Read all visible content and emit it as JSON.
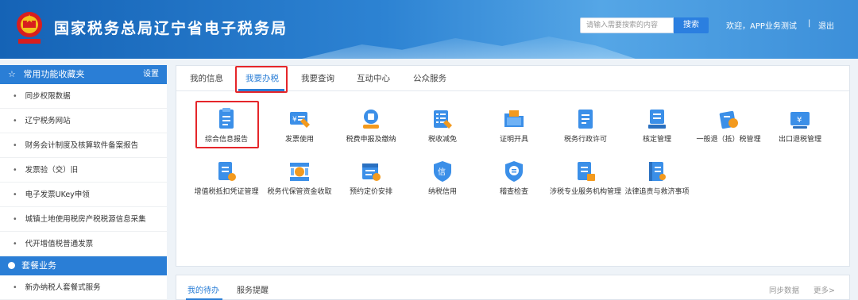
{
  "header": {
    "title": "国家税务总局辽宁省电子税务局",
    "search_placeholder": "请输入需要搜索的内容",
    "search_button": "搜索",
    "welcome": "欢迎，APP业务测试",
    "separator": "|",
    "logout": "退出"
  },
  "sidebar": {
    "section1": {
      "title": "常用功能收藏夹",
      "settings": "设置"
    },
    "items": [
      "同步权限数据",
      "辽宁税务网站",
      "财务会计制度及核算软件备案报告",
      "发票验（交）旧",
      "电子发票UKey申领",
      "城镇土地使用税房产税税源信息采集",
      "代开增值税普通发票"
    ],
    "section2": {
      "title": "套餐业务"
    },
    "items2": [
      "新办纳税人套餐式服务"
    ]
  },
  "tabs": [
    "我的信息",
    "我要办税",
    "我要查询",
    "互动中心",
    "公众服务"
  ],
  "active_tab": "我要办税",
  "tiles": [
    {
      "label": "综合信息报告",
      "icon": "document-report-icon"
    },
    {
      "label": "发票使用",
      "icon": "invoice-icon"
    },
    {
      "label": "税费申报及缴纳",
      "icon": "tax-declaration-icon"
    },
    {
      "label": "税收减免",
      "icon": "tax-relief-icon"
    },
    {
      "label": "证明开具",
      "icon": "folder-certificate-icon"
    },
    {
      "label": "税务行政许可",
      "icon": "license-icon"
    },
    {
      "label": "核定管理",
      "icon": "approval-icon"
    },
    {
      "label": "一般退（抵）税管理",
      "icon": "refund-icon"
    },
    {
      "label": "出口退税管理",
      "icon": "export-refund-icon"
    },
    {
      "label": "增值税抵扣凭证管理",
      "icon": "vat-voucher-icon"
    },
    {
      "label": "税务代保管资金收取",
      "icon": "fund-custody-icon"
    },
    {
      "label": "预约定价安排",
      "icon": "pricing-calendar-icon"
    },
    {
      "label": "纳税信用",
      "icon": "credit-icon"
    },
    {
      "label": "稽查检查",
      "icon": "inspection-icon"
    },
    {
      "label": "涉税专业服务机构管理",
      "icon": "service-agency-icon"
    },
    {
      "label": "法律追责与救济事项",
      "icon": "legal-book-icon"
    }
  ],
  "bottom": {
    "tabs": [
      "我的待办",
      "服务提醒"
    ],
    "sync": "同步数据",
    "more": "更多>"
  },
  "colors": {
    "primary": "#2a7ed6",
    "highlight": "#e5262a",
    "icon_blue": "#3b8fe8",
    "icon_orange": "#f39a1e"
  }
}
